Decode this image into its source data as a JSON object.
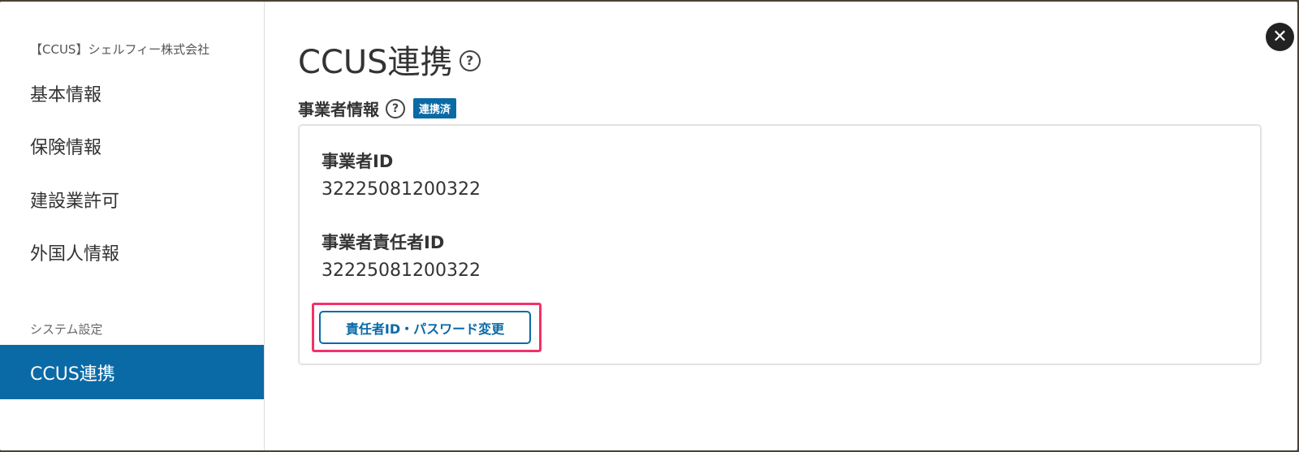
{
  "sidebar": {
    "company_name": "【CCUS】シェルフィー株式会社",
    "items": [
      {
        "label": "基本情報"
      },
      {
        "label": "保険情報"
      },
      {
        "label": "建設業許可"
      },
      {
        "label": "外国人情報"
      }
    ],
    "section_label": "システム設定",
    "active_item": {
      "label": "CCUS連携"
    }
  },
  "main": {
    "title": "CCUS連携",
    "section": {
      "title": "事業者情報",
      "badge": "連携済",
      "fields": [
        {
          "label": "事業者ID",
          "value": "32225081200322"
        },
        {
          "label": "事業者責任者ID",
          "value": "32225081200322"
        }
      ],
      "button_label": "責任者ID・パスワード変更"
    }
  },
  "icons": {
    "help": "question-circle-icon",
    "close": "close-icon"
  },
  "colors": {
    "accent": "#0a6aa6",
    "highlight": "#f0326a"
  }
}
